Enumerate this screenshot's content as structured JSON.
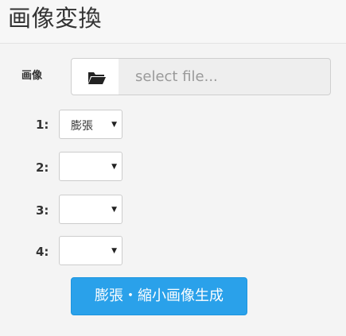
{
  "header": {
    "title": "画像変換"
  },
  "file": {
    "label": "画像",
    "button_icon": "folder-open-icon",
    "placeholder": "select file..."
  },
  "rows": [
    {
      "label": "1:",
      "selected": "膨張"
    },
    {
      "label": "2:",
      "selected": ""
    },
    {
      "label": "3:",
      "selected": ""
    },
    {
      "label": "4:",
      "selected": ""
    }
  ],
  "action": {
    "label": "膨張・縮小画像生成"
  },
  "colors": {
    "accent": "#2aa1ea",
    "background": "#f4f4f4"
  }
}
